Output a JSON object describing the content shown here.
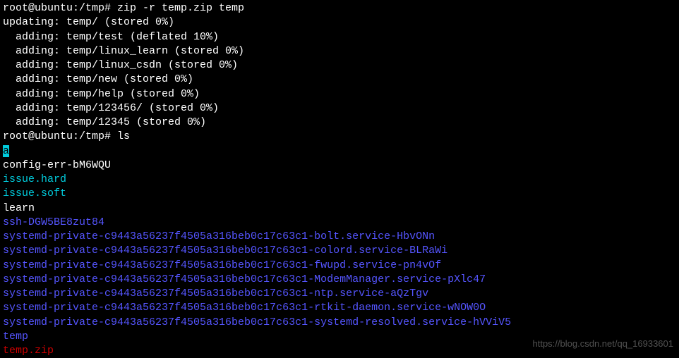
{
  "terminal": {
    "prompt1": "root@ubuntu:/tmp# ",
    "cmd1": "zip -r temp.zip temp",
    "zip_output": [
      "updating: temp/ (stored 0%)",
      "  adding: temp/test (deflated 10%)",
      "  adding: temp/linux_learn (stored 0%)",
      "  adding: temp/linux_csdn (stored 0%)",
      "  adding: temp/new (stored 0%)",
      "  adding: temp/help (stored 0%)",
      "  adding: temp/123456/ (stored 0%)",
      "  adding: temp/12345 (stored 0%)"
    ],
    "prompt2": "root@ubuntu:/tmp# ",
    "cmd2": "ls",
    "ls_entries": [
      {
        "text": "a",
        "color": "bg-cyan"
      },
      {
        "text": "config-err-bM6WQU",
        "color": "white"
      },
      {
        "text": "issue.hard",
        "color": "cyan"
      },
      {
        "text": "issue.soft",
        "color": "cyan"
      },
      {
        "text": "learn",
        "color": "white"
      },
      {
        "text": "ssh-DGW5BE8zut84",
        "color": "blue"
      },
      {
        "text": "systemd-private-c9443a56237f4505a316beb0c17c63c1-bolt.service-HbvONn",
        "color": "blue"
      },
      {
        "text": "systemd-private-c9443a56237f4505a316beb0c17c63c1-colord.service-BLRaWi",
        "color": "blue"
      },
      {
        "text": "systemd-private-c9443a56237f4505a316beb0c17c63c1-fwupd.service-pn4vOf",
        "color": "blue"
      },
      {
        "text": "systemd-private-c9443a56237f4505a316beb0c17c63c1-ModemManager.service-pXlc47",
        "color": "blue"
      },
      {
        "text": "systemd-private-c9443a56237f4505a316beb0c17c63c1-ntp.service-aQzTgv",
        "color": "blue"
      },
      {
        "text": "systemd-private-c9443a56237f4505a316beb0c17c63c1-rtkit-daemon.service-wNOW0O",
        "color": "blue"
      },
      {
        "text": "systemd-private-c9443a56237f4505a316beb0c17c63c1-systemd-resolved.service-hVViV5",
        "color": "blue"
      },
      {
        "text": "temp",
        "color": "blue"
      },
      {
        "text": "temp.zip",
        "color": "red"
      }
    ]
  },
  "watermark": "https://blog.csdn.net/qq_16933601"
}
